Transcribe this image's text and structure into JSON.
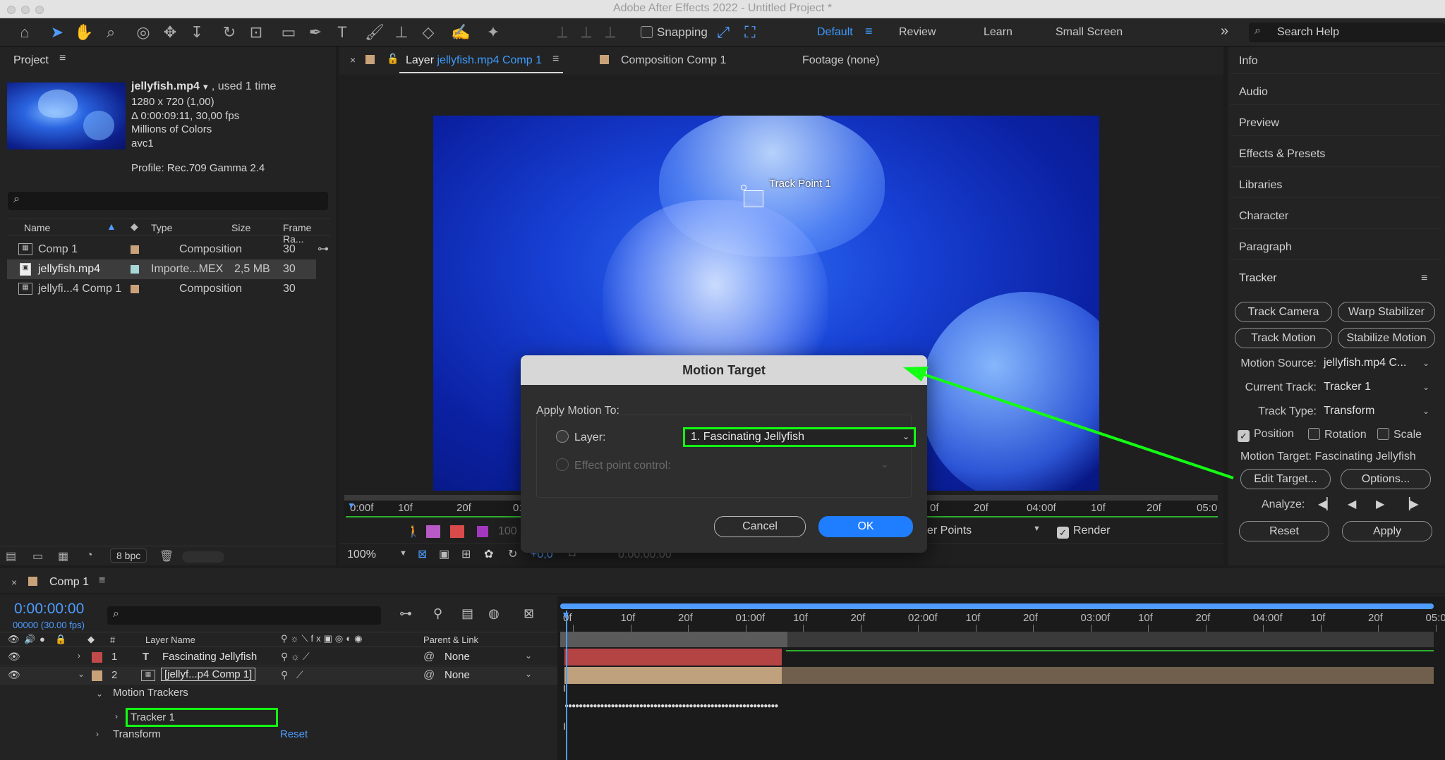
{
  "app": {
    "title": "Adobe After Effects 2022 - Untitled Project *"
  },
  "toolbar": {
    "snapping_label": "Snapping",
    "workspaces": [
      "Default",
      "Review",
      "Learn",
      "Small Screen"
    ],
    "search_placeholder": "Search Help",
    "overflow": "»"
  },
  "project": {
    "title": "Project",
    "item_name": "jellyfish.mp4",
    "used": ", used 1 time",
    "info_lines": [
      "1280 x 720 (1,00)",
      "Δ 0:00:09:11, 30,00 fps",
      "Millions of Colors",
      "avc1"
    ],
    "profile": "Profile: Rec.709 Gamma 2.4",
    "columns": [
      "Name",
      "Type",
      "Size",
      "Frame Ra..."
    ],
    "rows": [
      {
        "name": "Comp 1",
        "type": "Composition",
        "size": "",
        "fps": "30",
        "color": "#c9a27a"
      },
      {
        "name": "jellyfish.mp4",
        "type": "Importe...MEX",
        "size": "2,5 MB",
        "fps": "30",
        "color": "#a7d7d7"
      },
      {
        "name": "jellyfi...4 Comp 1",
        "type": "Composition",
        "size": "",
        "fps": "30",
        "color": "#c9a27a"
      }
    ],
    "bpc": "8 bpc"
  },
  "viewer": {
    "tabs": [
      {
        "prefix": "Layer",
        "name": "jellyfish.mp4 Comp 1"
      },
      {
        "prefix": "",
        "name": "Composition Comp 1"
      },
      {
        "prefix": "",
        "name": "Footage (none)"
      }
    ],
    "track_point_label": "Track Point 1",
    "ruler_left": [
      "0:00f",
      "10f",
      "20f",
      "01:"
    ],
    "ruler_right": [
      "0f",
      "20f",
      "04:00f",
      "10f",
      "20f",
      "05:0"
    ],
    "view_opacity": "100",
    "view_menu": "cker Points",
    "render_label": "Render",
    "zoom": "100%",
    "exposure": "+0,0",
    "timecode": "0:00:00:00"
  },
  "dialog": {
    "title": "Motion Target",
    "group_label": "Apply Motion To:",
    "layer_label": "Layer:",
    "layer_value": "1. Fascinating Jellyfish",
    "effect_label": "Effect point control:",
    "cancel": "Cancel",
    "ok": "OK"
  },
  "right_panels": [
    "Info",
    "Audio",
    "Preview",
    "Effects & Presets",
    "Libraries",
    "Character",
    "Paragraph"
  ],
  "tracker": {
    "title": "Tracker",
    "buttons": [
      "Track Camera",
      "Warp Stabilizer",
      "Track Motion",
      "Stabilize Motion"
    ],
    "motion_source_label": "Motion Source:",
    "motion_source_value": "jellyfish.mp4 C...",
    "current_track_label": "Current Track:",
    "current_track_value": "Tracker 1",
    "track_type_label": "Track Type:",
    "track_type_value": "Transform",
    "position_label": "Position",
    "rotation_label": "Rotation",
    "scale_label": "Scale",
    "motion_target": "Motion Target: Fascinating Jellyfish",
    "edit_target": "Edit Target...",
    "options": "Options...",
    "analyze_label": "Analyze:",
    "reset": "Reset",
    "apply": "Apply"
  },
  "timeline": {
    "comp_tab": "Comp 1",
    "timecode": "0:00:00:00",
    "frames": "00000 (30.00 fps)",
    "col_num": "#",
    "col_layer_name": "Layer Name",
    "col_parent": "Parent & Link",
    "layers": [
      {
        "num": "1",
        "name": "Fascinating Jellyfish",
        "parent": "None",
        "color": "#c24a4a"
      },
      {
        "num": "2",
        "name": "[jellyf...p4 Comp 1]",
        "parent": "None",
        "color": "#c9a27a"
      }
    ],
    "motion_trackers": "Motion Trackers",
    "tracker1": "Tracker 1",
    "transform": "Transform",
    "reset": "Reset",
    "ruler": [
      "0f",
      "10f",
      "20f",
      "01:00f",
      "10f",
      "20f",
      "02:00f",
      "10f",
      "20f",
      "03:00f",
      "10f",
      "20f",
      "04:00f",
      "10f",
      "20f",
      "05:0"
    ]
  }
}
